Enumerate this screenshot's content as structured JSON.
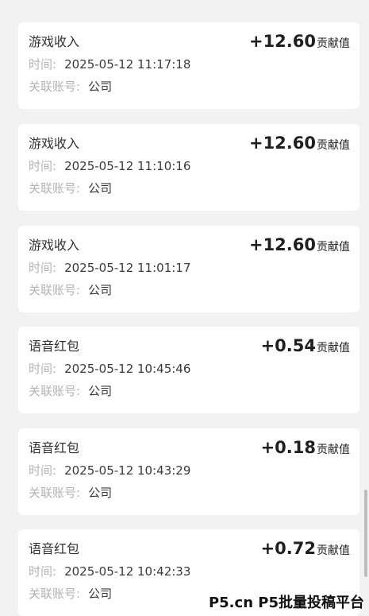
{
  "records": [
    {
      "title": "游戏收入",
      "amount": "+12.60",
      "unit": "贡献值",
      "time_label": "时间:",
      "time": "2025-05-12 11:17:18",
      "account_label": "关联账号:",
      "account": "公司"
    },
    {
      "title": "游戏收入",
      "amount": "+12.60",
      "unit": "贡献值",
      "time_label": "时间:",
      "time": "2025-05-12 11:10:16",
      "account_label": "关联账号:",
      "account": "公司"
    },
    {
      "title": "游戏收入",
      "amount": "+12.60",
      "unit": "贡献值",
      "time_label": "时间:",
      "time": "2025-05-12 11:01:17",
      "account_label": "关联账号:",
      "account": "公司"
    },
    {
      "title": "语音红包",
      "amount": "+0.54",
      "unit": "贡献值",
      "time_label": "时间:",
      "time": "2025-05-12 10:45:46",
      "account_label": "关联账号:",
      "account": "公司"
    },
    {
      "title": "语音红包",
      "amount": "+0.18",
      "unit": "贡献值",
      "time_label": "时间:",
      "time": "2025-05-12 10:43:29",
      "account_label": "关联账号:",
      "account": "公司"
    },
    {
      "title": "语音红包",
      "amount": "+0.72",
      "unit": "贡献值",
      "time_label": "时间:",
      "time": "2025-05-12 10:42:33",
      "account_label": "关联账号:",
      "account": "公司"
    }
  ],
  "watermark": "P5.cn P5批量投稿平台"
}
